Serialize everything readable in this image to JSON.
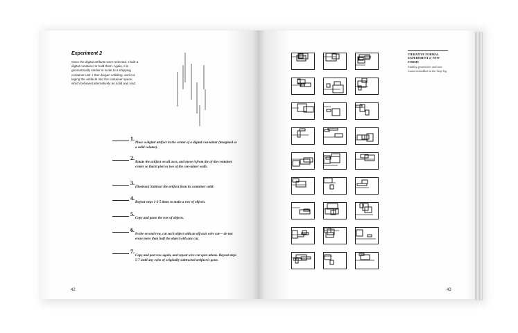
{
  "left_page": {
    "title": "Experiment 2",
    "body": "Once the digital artifacts were selected, I built a digital container to hold them. Again, it is geometrically similar in scale to a shipping container unit. I then began colliding, and col-laging the artifacts into the container space, which behaved alternatively as solid and void.",
    "steps": [
      {
        "num": "1.",
        "text": "Place a digital artifact in the center of a digital con-tainer (imagined as a solid volume)."
      },
      {
        "num": "2.",
        "text": "Rotate the artifact on all axes, and move it from the of the container center so that it pierces two of the con-tainer walls."
      },
      {
        "num": "3.",
        "text": "(Boolean) Subtract the artifact from its container solid."
      },
      {
        "num": "4.",
        "text": "Repeat steps 1-3 5 times to make a row of objects."
      },
      {
        "num": "5.",
        "text": "Copy and paste the row of objects."
      },
      {
        "num": "6.",
        "text": "In the second row, cut each object with an off-axis wire cut— do not erase more than half the object with any cut."
      },
      {
        "num": "7.",
        "text": "Copy and past row again, and repeat wire-cut oper-ations. Repeat steps 5-7 until any echo of originally subtracted artifact is gone."
      }
    ],
    "page_number": "42"
  },
  "right_page": {
    "heading": "ITERATIVE FORMAL EXPERIMENT 2; NEW FORMS",
    "caption": "Finding geometries and new forms embedded in the Step-Jig.",
    "page_number": "43"
  }
}
